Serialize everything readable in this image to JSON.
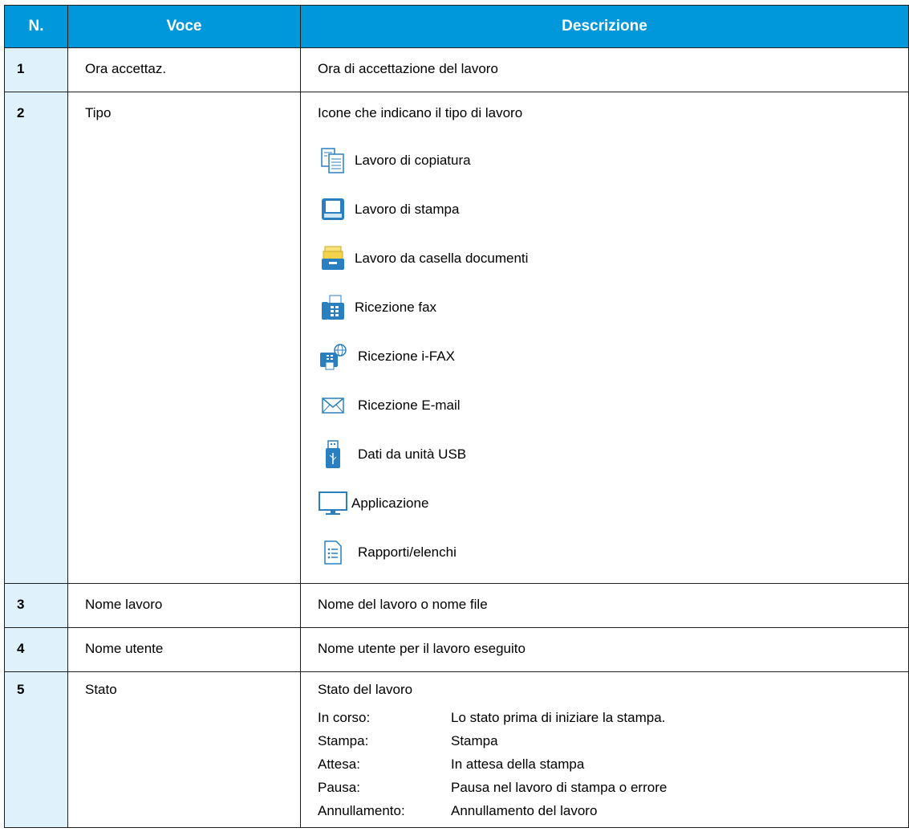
{
  "headers": {
    "num": "N.",
    "item": "Voce",
    "desc": "Descrizione"
  },
  "rows": [
    {
      "num": "1",
      "item": "Ora accettaz.",
      "desc": "Ora di accettazione del lavoro"
    },
    {
      "num": "2",
      "item": "Tipo",
      "desc": "Icone che indicano il tipo di lavoro",
      "types": [
        {
          "icon": "copy-job-icon",
          "label": "Lavoro di copiatura"
        },
        {
          "icon": "print-job-icon",
          "label": "Lavoro di stampa"
        },
        {
          "icon": "document-box-job-icon",
          "label": "Lavoro da casella documenti"
        },
        {
          "icon": "fax-receive-icon",
          "label": "Ricezione fax"
        },
        {
          "icon": "ifax-receive-icon",
          "label": "Ricezione i-FAX"
        },
        {
          "icon": "email-receive-icon",
          "label": "Ricezione E-mail"
        },
        {
          "icon": "usb-drive-icon",
          "label": "Dati da unità USB"
        },
        {
          "icon": "application-monitor-icon",
          "label": "Applicazione"
        },
        {
          "icon": "report-list-icon",
          "label": "Rapporti/elenchi"
        }
      ]
    },
    {
      "num": "3",
      "item": "Nome lavoro",
      "desc": "Nome del lavoro o nome file"
    },
    {
      "num": "4",
      "item": "Nome utente",
      "desc": "Nome utente per il lavoro eseguito"
    },
    {
      "num": "5",
      "item": "Stato",
      "desc": "Stato del lavoro",
      "states": [
        {
          "key": "In corso:",
          "value": "Lo stato prima di iniziare la stampa."
        },
        {
          "key": "Stampa:",
          "value": "Stampa"
        },
        {
          "key": "Attesa:",
          "value": "In attesa della stampa"
        },
        {
          "key": "Pausa:",
          "value": "Pausa nel lavoro di stampa o errore"
        },
        {
          "key": "Annullamento:",
          "value": "Annullamento del lavoro"
        }
      ]
    }
  ],
  "colors": {
    "header_bg": "#0098db",
    "num_bg": "#dff1fb",
    "border": "#1d1d1b"
  }
}
